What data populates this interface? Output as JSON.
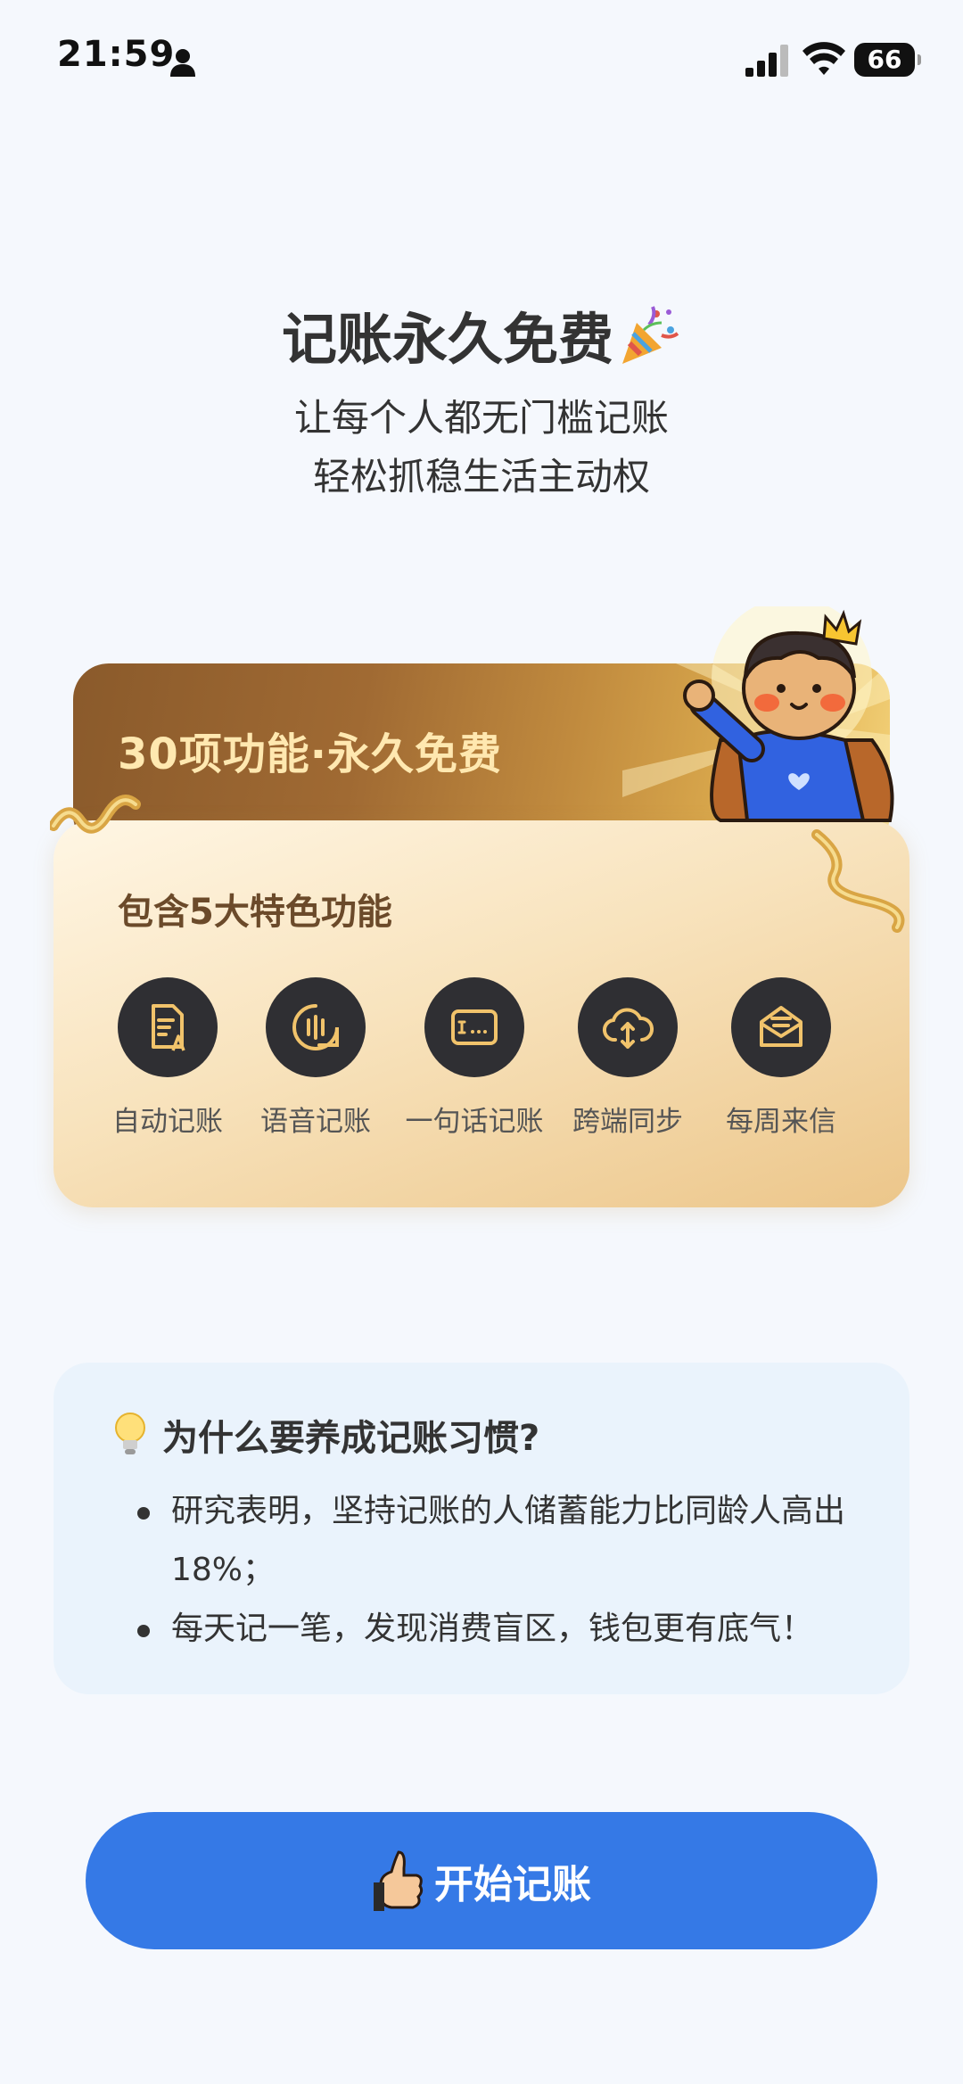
{
  "status_bar": {
    "time": "21:59",
    "battery": "66",
    "icons": [
      "person-icon",
      "signal-icon",
      "wifi-icon",
      "battery-icon"
    ]
  },
  "header": {
    "title": "记账永久免费",
    "title_icon": "party-popper-icon",
    "subtitle_line1": "让每个人都无门槛记账",
    "subtitle_line2": "轻松抓稳生活主动权"
  },
  "feature_card": {
    "banner_text": "30项功能·永久免费",
    "section_title": "包含5大特色功能",
    "features": [
      {
        "label": "自动记账",
        "icon": "auto-document-icon"
      },
      {
        "label": "语音记账",
        "icon": "voice-icon"
      },
      {
        "label": "一句话记账",
        "icon": "text-input-icon"
      },
      {
        "label": "跨端同步",
        "icon": "cloud-sync-icon"
      },
      {
        "label": "每周来信",
        "icon": "mail-icon"
      }
    ]
  },
  "why": {
    "title": "为什么要养成记账习惯?",
    "items": [
      "研究表明，坚持记账的人储蓄能力比同龄人高出18%；",
      "每天记一笔，发现消费盲区，钱包更有底气！"
    ]
  },
  "cta": {
    "label": "开始记账",
    "icon": "thumbs-up-icon"
  },
  "colors": {
    "background": "#f5f8fd",
    "primary_button": "#3579e6",
    "icon_circle": "#2f2f33",
    "icon_gold": "#f1c36b",
    "why_card": "#eaf3fc"
  }
}
